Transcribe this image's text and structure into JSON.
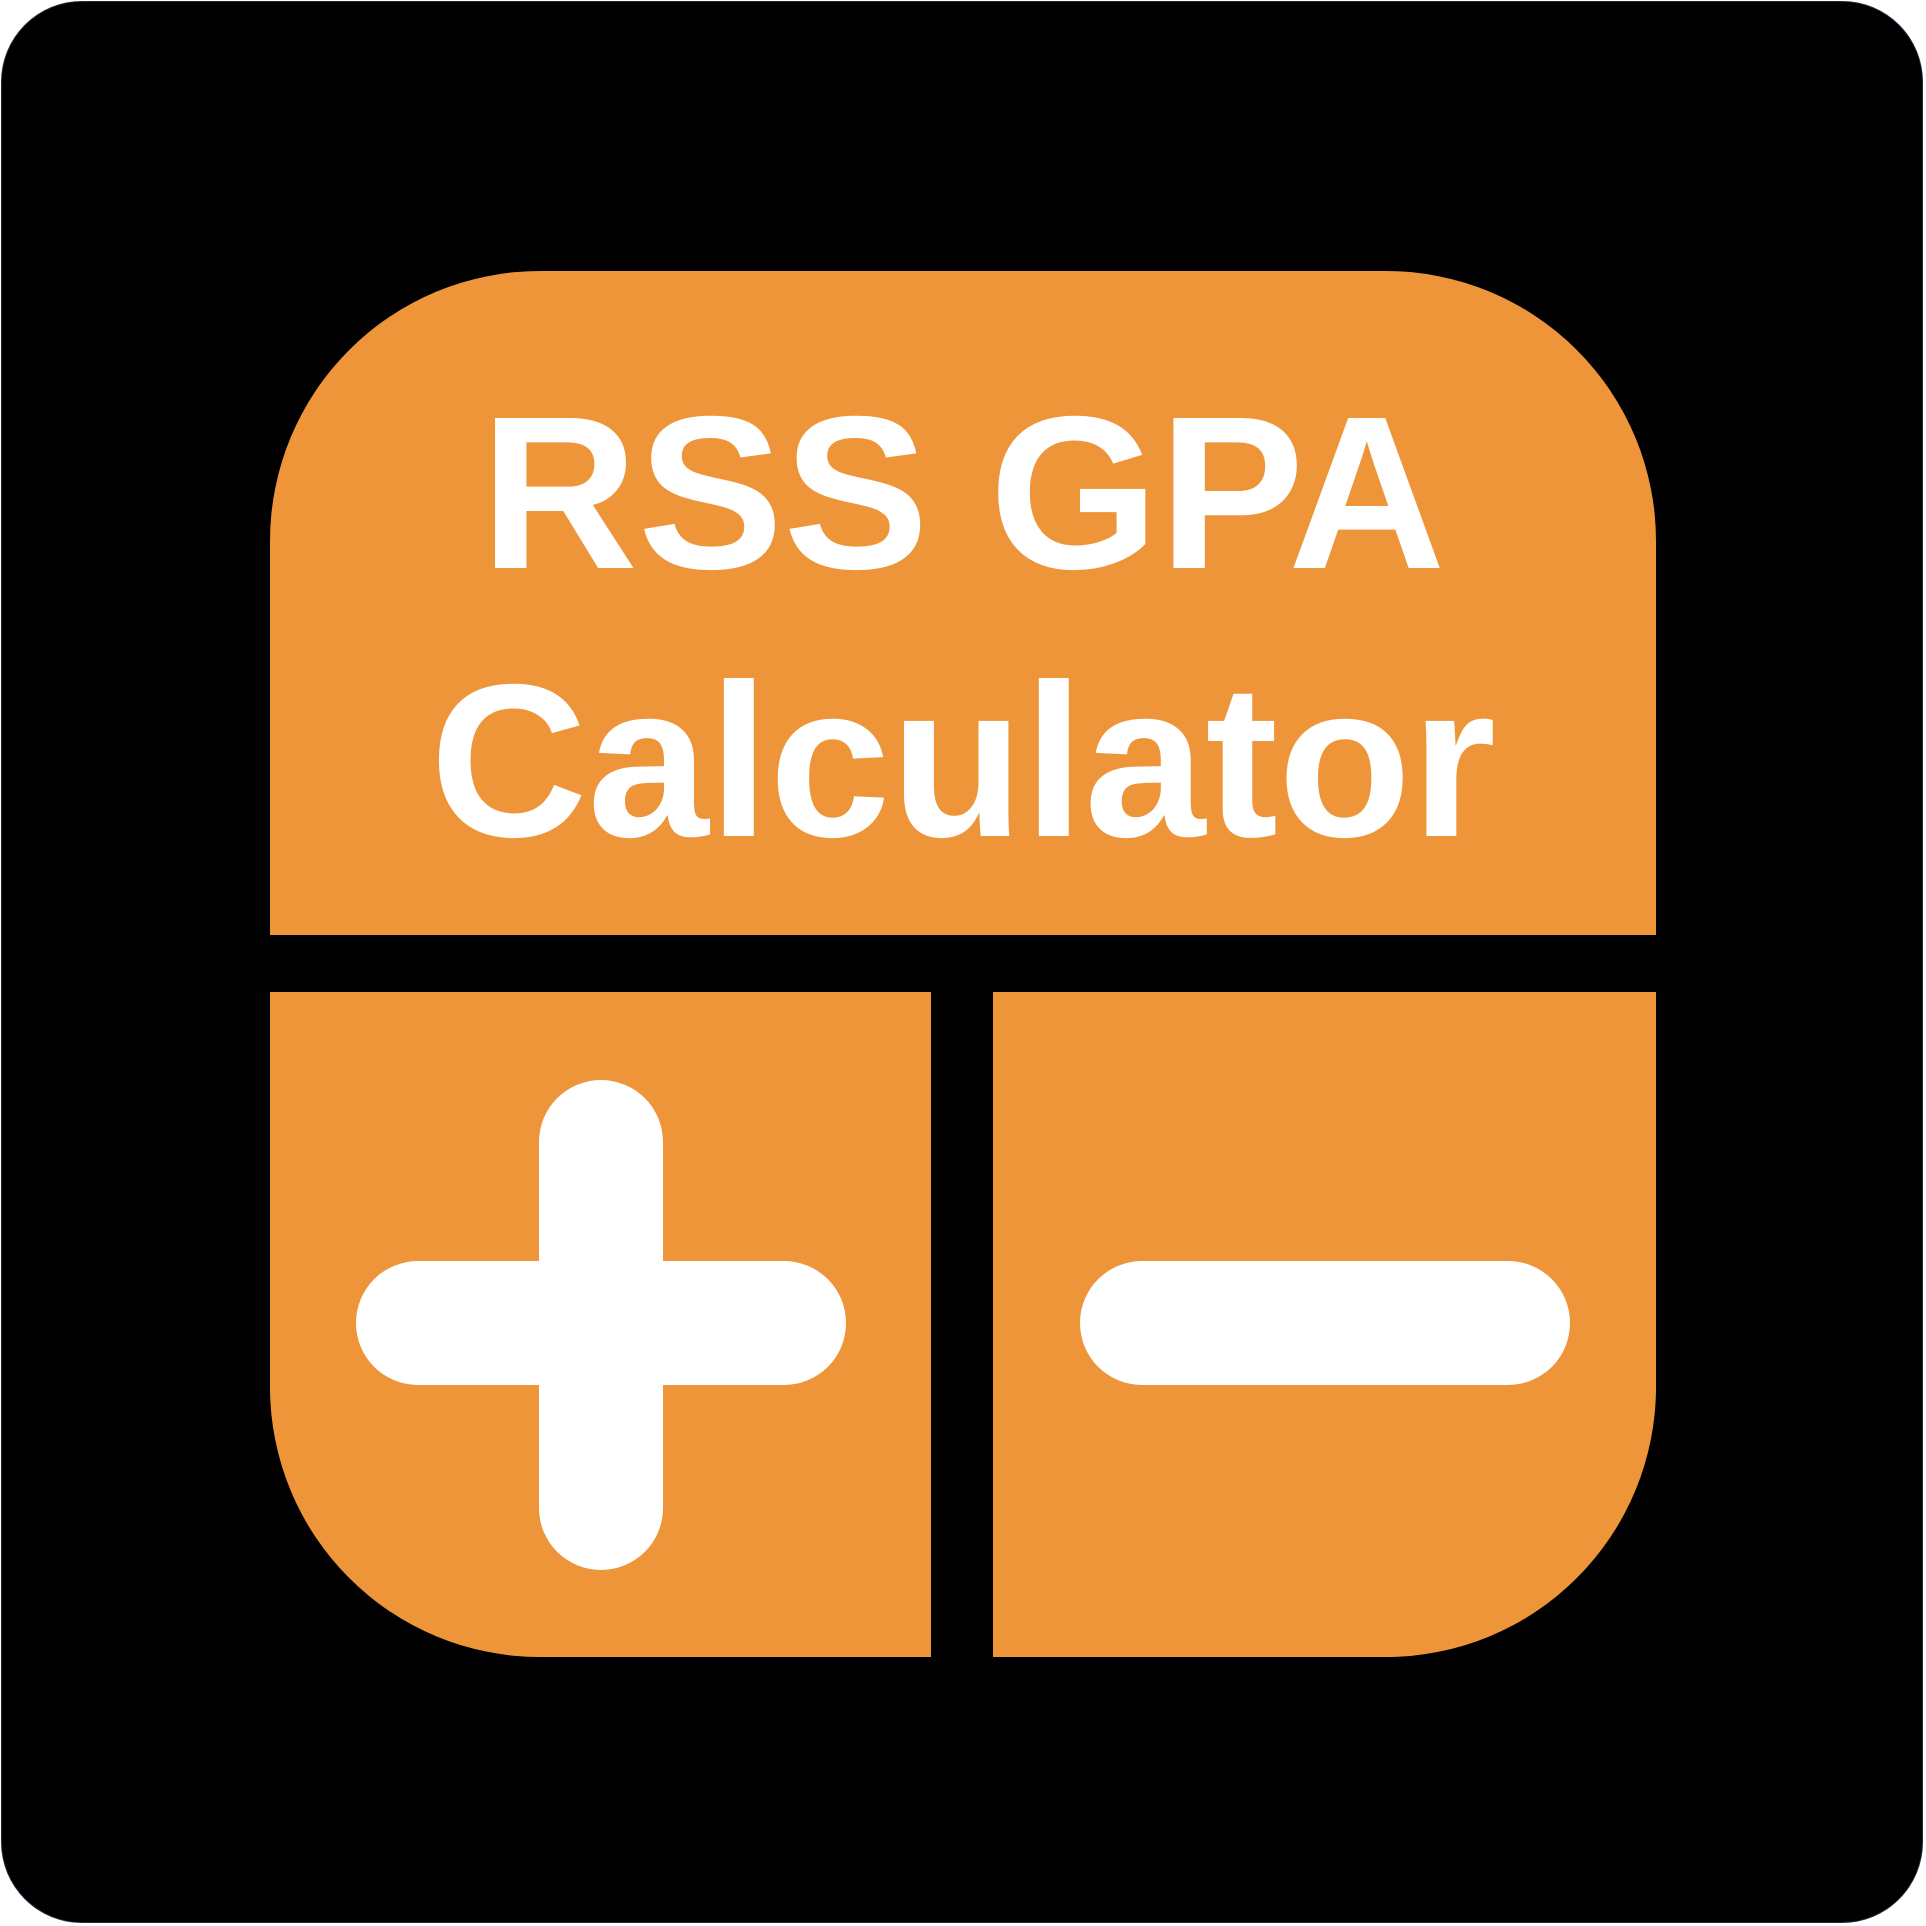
{
  "app_icon": {
    "title_line1": "RSS GPA",
    "title_line2": "Calculator",
    "icons": {
      "add": "plus-icon",
      "subtract": "minus-icon"
    },
    "colors": {
      "background": "#000000",
      "accent": "#ee953a",
      "foreground": "#ffffff"
    }
  }
}
